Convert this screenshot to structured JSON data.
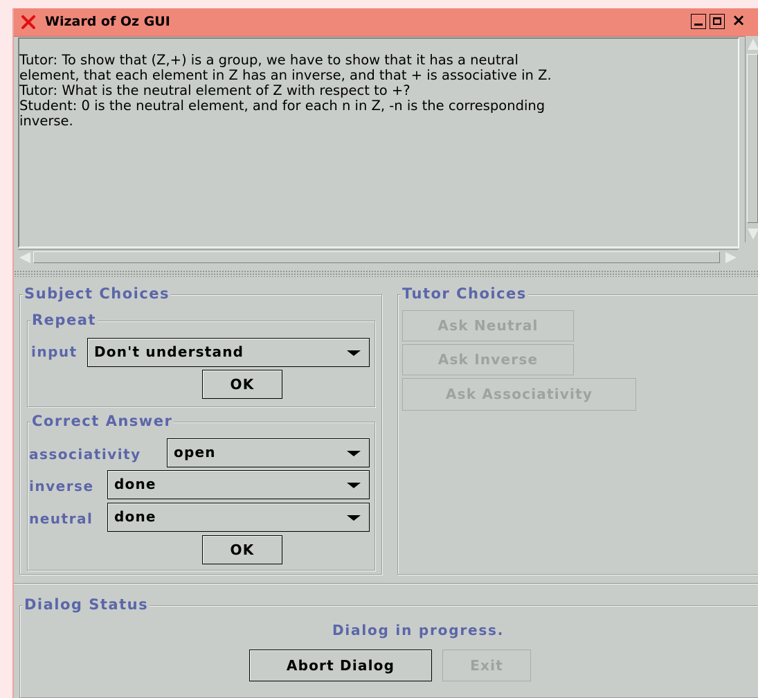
{
  "window": {
    "title": "Wizard of Oz GUI",
    "controls": {
      "minimize": "_",
      "maximize": "□",
      "close": "×"
    },
    "colors": {
      "titlebar": "#f0887a",
      "background": "#c9cdca",
      "label": "#5b66a9"
    }
  },
  "dialog_log": {
    "lines": [
      "Tutor: To show that (Z,+) is a group, we have to show that it has a neutral",
      "element, that each element in Z has an inverse, and that + is associative in Z.",
      "Tutor: What is the neutral element of Z with respect to +?",
      "Student: 0 is the neutral element, and for each n in Z, -n is the corresponding",
      "inverse."
    ]
  },
  "subject_choices": {
    "title": "Subject Choices",
    "repeat": {
      "title": "Repeat",
      "input_label": "input",
      "input_value": "Don't understand",
      "ok_label": "OK"
    },
    "correct_answer": {
      "title": "Correct Answer",
      "associativity_label": "associativity",
      "associativity_value": "open",
      "inverse_label": "inverse",
      "inverse_value": "done",
      "neutral_label": "neutral",
      "neutral_value": "done",
      "ok_label": "OK"
    }
  },
  "tutor_choices": {
    "title": "Tutor Choices",
    "buttons": [
      "Ask Neutral",
      "Ask Inverse",
      "Ask Associativity"
    ]
  },
  "dialog_status": {
    "title": "Dialog Status",
    "text": "Dialog in progress.",
    "abort_label": "Abort Dialog",
    "exit_label": "Exit"
  }
}
